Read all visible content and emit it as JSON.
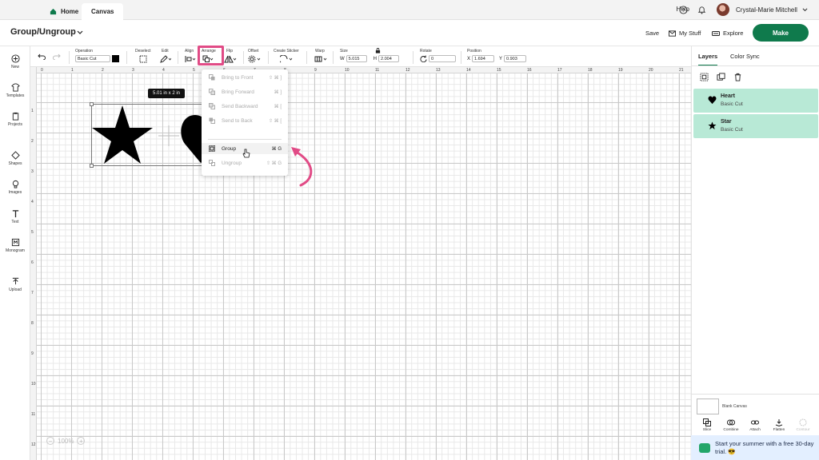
{
  "nav": {
    "home": "Home",
    "canvas": "Canvas",
    "help": "Help",
    "user": "Crystal-Marie Mitchell"
  },
  "title_bar": {
    "project_title": "Group/Ungroup",
    "save": "Save",
    "my_stuff": "My Stuff",
    "explore": "Explore",
    "make": "Make"
  },
  "toolbar": {
    "operation_label": "Operation",
    "operation_value": "Basic Cut",
    "deselect": "Deselect",
    "edit": "Edit",
    "align": "Align",
    "arrange": "Arrange",
    "flip": "Flip",
    "offset": "Offset",
    "create_sticker": "Create Sticker",
    "warp": "Warp",
    "size": "Size",
    "w_label": "W",
    "w_value": "5.015",
    "h_label": "H",
    "h_value": "2.004",
    "rotate": "Rotate",
    "rotate_value": "0",
    "position": "Position",
    "x_label": "X",
    "x_value": "1.694",
    "y_label": "Y",
    "y_value": "0.903"
  },
  "left_toolbar": [
    "New",
    "Templates",
    "Projects",
    "Shapes",
    "Images",
    "Text",
    "Monogram",
    "Upload"
  ],
  "ruler": {
    "top": [
      "0",
      "1",
      "2",
      "3",
      "4",
      "5",
      "6",
      "7",
      "8",
      "9",
      "10",
      "11",
      "12",
      "13",
      "14",
      "15",
      "16",
      "17",
      "18",
      "19",
      "20",
      "21"
    ],
    "left": [
      "1",
      "2",
      "3",
      "4",
      "5",
      "6",
      "7",
      "8",
      "9",
      "10",
      "11",
      "12"
    ]
  },
  "canvas": {
    "size_tooltip": "5.01 in x 2 in",
    "zoom": "100%",
    "zoom_minus": "−",
    "zoom_plus": "+"
  },
  "arrange_menu": {
    "items": [
      {
        "label": "Bring to Front",
        "shortcut": "⇧ ⌘ ]",
        "enabled": false
      },
      {
        "label": "Bring Forward",
        "shortcut": "⌘ ]",
        "enabled": false
      },
      {
        "label": "Send Backward",
        "shortcut": "⌘ [",
        "enabled": false
      },
      {
        "label": "Send to Back",
        "shortcut": "⇧ ⌘ [",
        "enabled": false
      },
      {
        "label": "Group",
        "shortcut": "⌘ G",
        "enabled": true
      },
      {
        "label": "Ungroup",
        "shortcut": "⇧ ⌘ G",
        "enabled": false
      }
    ]
  },
  "layers_panel": {
    "tabs": [
      "Layers",
      "Color Sync"
    ],
    "layers": [
      {
        "name": "Heart",
        "operation": "Basic Cut"
      },
      {
        "name": "Star",
        "operation": "Basic Cut"
      }
    ],
    "blank_canvas": "Blank Canvas",
    "bottom_tools": [
      "Slice",
      "Combine",
      "Attach",
      "Flatten",
      "Contour"
    ]
  },
  "promo": {
    "text": "Start your summer with a free 30-day trial. 😎"
  },
  "colors": {
    "accent_green": "#0f7a4c",
    "highlight_pink": "#e14b86",
    "layer_bg": "#b8e9d6"
  }
}
